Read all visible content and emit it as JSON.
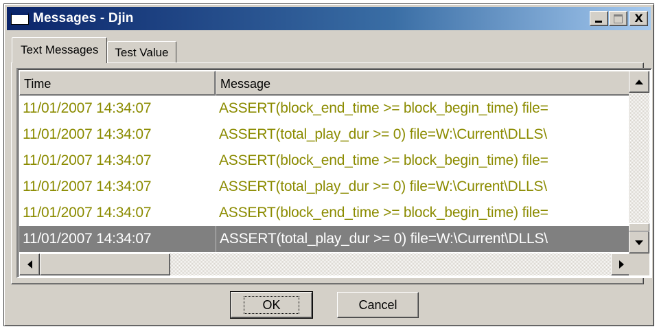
{
  "window": {
    "title": "Messages - Djin",
    "controls": [
      "minimize-icon",
      "maximize-icon",
      "close-icon"
    ],
    "close_glyph": "X"
  },
  "tabs": [
    {
      "label": "Text Messages",
      "active": true
    },
    {
      "label": "Test Value",
      "active": false
    }
  ],
  "table": {
    "columns": [
      "Time",
      "Message"
    ],
    "rows": [
      {
        "time": "11/01/2007 14:34:07",
        "message": "ASSERT(block_end_time >= block_begin_time) file=",
        "selected": false
      },
      {
        "time": "11/01/2007 14:34:07",
        "message": "ASSERT(total_play_dur >= 0) file=W:\\Current\\DLLS\\",
        "selected": false
      },
      {
        "time": "11/01/2007 14:34:07",
        "message": "ASSERT(block_end_time >= block_begin_time) file=",
        "selected": false
      },
      {
        "time": "11/01/2007 14:34:07",
        "message": "ASSERT(total_play_dur >= 0) file=W:\\Current\\DLLS\\",
        "selected": false
      },
      {
        "time": "11/01/2007 14:34:07",
        "message": "ASSERT(block_end_time >= block_begin_time) file=",
        "selected": false
      },
      {
        "time": "11/01/2007 14:34:07",
        "message": "ASSERT(total_play_dur >= 0) file=W:\\Current\\DLLS\\",
        "selected": true
      }
    ]
  },
  "buttons": {
    "ok": "OK",
    "cancel": "Cancel"
  },
  "colors": {
    "title_bar": "#0a246a",
    "row_text": "#8b8b00",
    "selected_row": "#808080",
    "face": "#d4d0c8"
  }
}
